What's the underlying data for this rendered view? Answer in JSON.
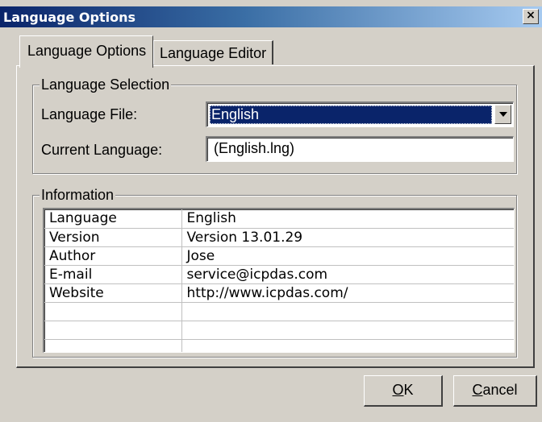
{
  "window": {
    "title": "Language Options",
    "close_glyph": "×"
  },
  "tabs": [
    {
      "label": "Language Options",
      "active": true
    },
    {
      "label": "Language Editor",
      "active": false
    }
  ],
  "language_selection": {
    "group_label": "Language Selection",
    "file_label": "Language File:",
    "file_value": "English",
    "current_label": "Current Language:",
    "current_value": "(English.lng)"
  },
  "information": {
    "group_label": "Information",
    "rows": [
      {
        "key": "Language",
        "value": "English"
      },
      {
        "key": "Version",
        "value": "Version 13.01.29"
      },
      {
        "key": "Author",
        "value": "Jose"
      },
      {
        "key": "E-mail",
        "value": "service@icpdas.com"
      },
      {
        "key": "Website",
        "value": "http://www.icpdas.com/"
      },
      {
        "key": "",
        "value": ""
      },
      {
        "key": "",
        "value": ""
      },
      {
        "key": "",
        "value": ""
      }
    ]
  },
  "buttons": {
    "ok_mnemonic": "O",
    "ok_rest": "K",
    "cancel_mnemonic": "C",
    "cancel_rest": "ancel"
  },
  "colors": {
    "title_bar": "#0a246a",
    "face": "#d4d0c8",
    "selection": "#0a246a"
  }
}
